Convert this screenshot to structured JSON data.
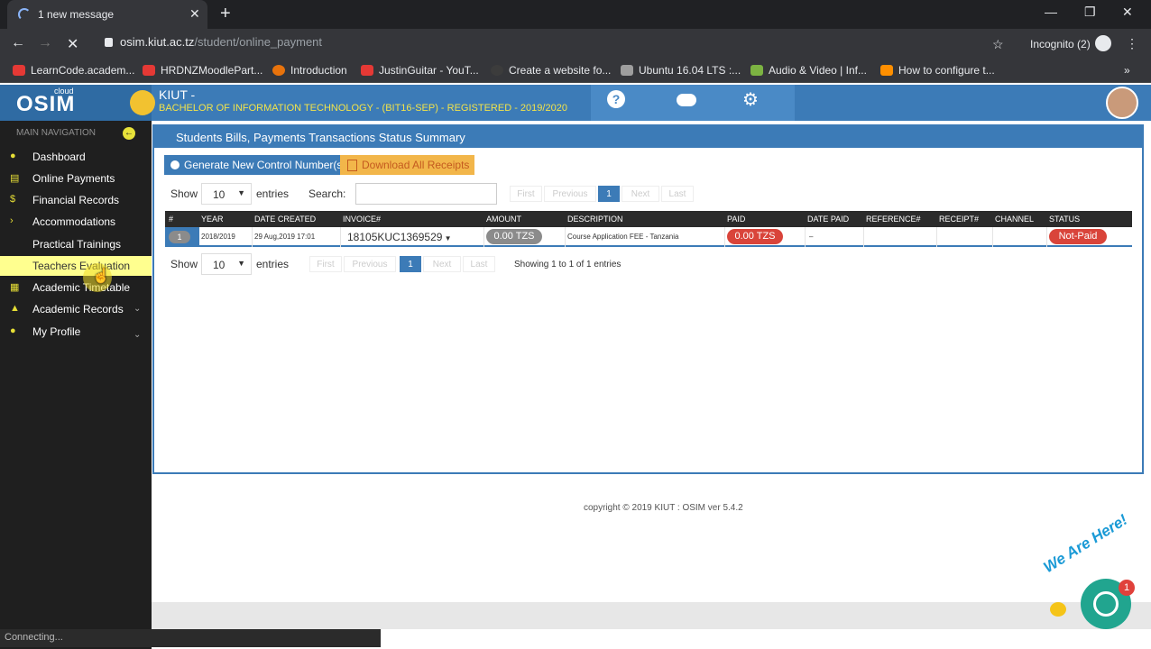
{
  "browser": {
    "tab_title": "1 new message",
    "url_host": "osim.kiut.ac.tz",
    "url_path": "/student/online_payment",
    "profile_label": "Incognito (2)",
    "bookmarks": [
      {
        "label": "LearnCode.academ...",
        "color": "#e53935"
      },
      {
        "label": "HRDNZMoodlePart...",
        "color": "#e53935"
      },
      {
        "label": "Introduction",
        "color": "#e8730c"
      },
      {
        "label": "JustinGuitar - YouT...",
        "color": "#e53935"
      },
      {
        "label": "Create a website fo...",
        "color": "#3c3c3c"
      },
      {
        "label": "Ubuntu 16.04 LTS :...",
        "color": "#9e9e9e"
      },
      {
        "label": "Audio & Video | Inf...",
        "color": "#7cb342"
      },
      {
        "label": "How to configure t...",
        "color": "#ff8f00"
      }
    ],
    "more_bookmarks": "»"
  },
  "app": {
    "logo": "OSIM",
    "logo_sup": "cloud",
    "institution": "KIUT -",
    "programme": "BACHELOR OF INFORMATION TECHNOLOGY - (BIT16-SEP) - REGISTERED - 2019/2020",
    "header_icons": [
      "help-icon",
      "chat-icon",
      "settings-icon"
    ]
  },
  "sidebar": {
    "heading": "MAIN NAVIGATION",
    "items": [
      {
        "label": "Dashboard",
        "icon": "dashboard-icon",
        "glyph": "●"
      },
      {
        "label": "Online Payments",
        "icon": "card-icon",
        "glyph": "▤"
      },
      {
        "label": "Financial Records",
        "icon": "dollar-icon",
        "glyph": "$"
      },
      {
        "label": "Accommodations",
        "icon": "chevron-right-icon",
        "glyph": "›"
      },
      {
        "label": "Practical Trainings",
        "icon": "",
        "glyph": ""
      },
      {
        "label": "Teachers Evaluation",
        "icon": "",
        "glyph": ""
      },
      {
        "label": "Academic Timetable",
        "icon": "calendar-icon",
        "glyph": "▦"
      },
      {
        "label": "Academic Records",
        "icon": "graduation-cap-icon",
        "glyph": "▲"
      },
      {
        "label": "My Profile",
        "icon": "user-icon",
        "glyph": "●"
      }
    ],
    "active_index": 5
  },
  "panel": {
    "title": "Students Bills, Payments Transactions Status Summary",
    "generate_button": "Generate New Control Number(s)",
    "download_button": "Download All Receipts",
    "show_label": "Show",
    "entries_label": "entries",
    "page_size": "10",
    "search_label": "Search:",
    "search_value": "",
    "pagination": {
      "first": "First",
      "previous": "Previous",
      "current": "1",
      "next": "Next",
      "last": "Last"
    },
    "info": "Showing 1 to 1 of 1 entries",
    "columns": [
      "#",
      "YEAR",
      "DATE CREATED",
      "INVOICE#",
      "AMOUNT",
      "DESCRIPTION",
      "PAID",
      "DATE PAID",
      "REFERENCE#",
      "RECEIPT#",
      "CHANNEL",
      "STATUS"
    ],
    "rows": [
      {
        "num": "1",
        "year": "2018/2019",
        "date_created": "29 Aug,2019 17:01",
        "invoice": "18105KUC1369529",
        "amount": "0.00 TZS",
        "description": "Course Application FEE - Tanzania",
        "paid": "0.00 TZS",
        "date_paid": "–",
        "reference": "",
        "receipt": "",
        "channel": "",
        "status": "Not-Paid"
      }
    ]
  },
  "footer": {
    "copyright": "copyright © 2019 KIUT : OSIM ver 5.4.2",
    "status_text": "Connecting..."
  },
  "chat": {
    "badge": "1",
    "tagline": "We Are Here!"
  },
  "colors": {
    "accent": "#3c7bb7",
    "sidebar_bg": "#1f1f1f",
    "icon_yellow": "#e6de36",
    "danger": "#d9443a",
    "warning": "#f2b64a"
  }
}
